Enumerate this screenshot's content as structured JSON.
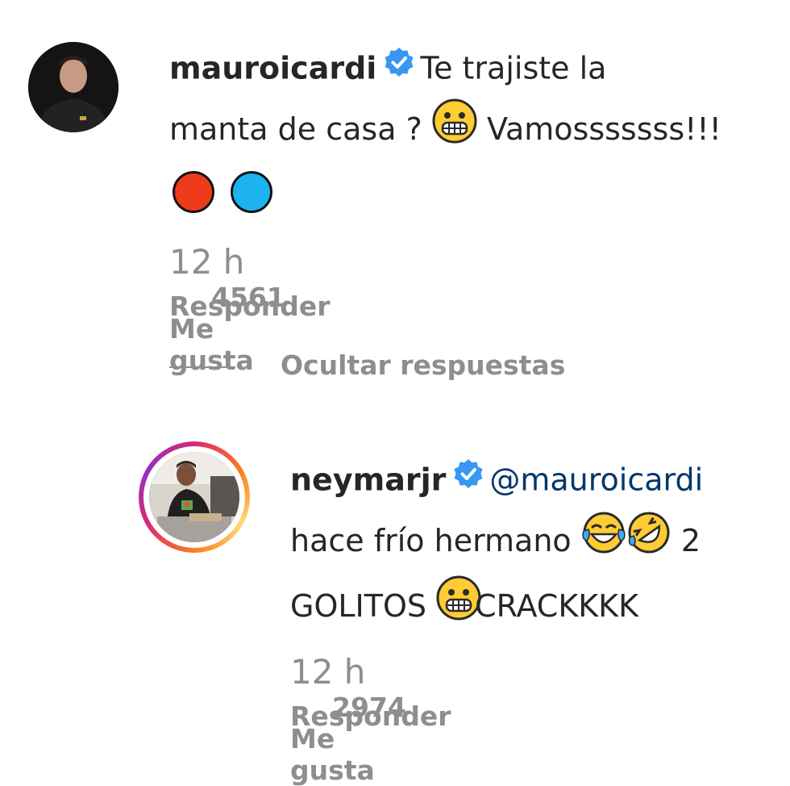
{
  "comment1": {
    "username": "mauroicardi",
    "text_line1": "Te trajiste la",
    "text_line2_a": "manta de casa ?",
    "text_line2_b": "Vamosssssss!!!",
    "time": "12 h",
    "likes": "4561 Me gusta",
    "reply": "Responder",
    "circle_colors": [
      "#ee3b1b",
      "#1cb3ee"
    ]
  },
  "hide_replies": "Ocultar respuestas",
  "comment2": {
    "username": "neymarjr",
    "mention": "@mauroicardi",
    "text_line1": "hace frío hermano",
    "text_line1_end": "2",
    "text_line2_a": "GOLITOS",
    "text_line2_b": "CRACKKKK",
    "time": "12 h",
    "likes": "2974 Me gusta",
    "reply": "Responder"
  },
  "colors": {
    "verified": "#3897f0",
    "mention": "#00376b",
    "muted": "#8e8e8e"
  }
}
